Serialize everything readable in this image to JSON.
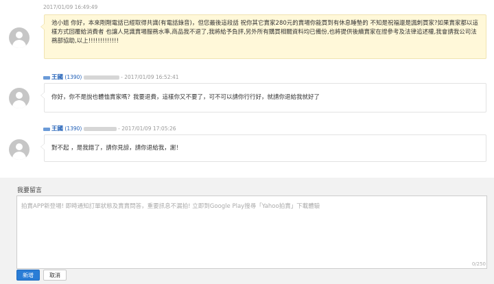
{
  "messages": [
    {
      "timestamp": "2017/01/09 16:49:49",
      "text": "池小姐 你好，本來剛剛電話已經取得共識(有電話錄音)，但您最後這段話 祝你其它賣家280元的賣場你能買到有休息睡墊的 不知是祝福還是諷刺買家?如果賣家都以這樣方式回覆給消費者 也讓人見識賣場服務水準,商品我不退了,我將給予負評,另外所有購買相關資料均已備份,也將提供後續賣家在證參考及法律追述權,我會請我公司法務部協助,以上!!!!!!!!!!!!!"
    },
    {
      "name": "王國",
      "uid": "(1390)",
      "separator": "-",
      "timestamp": "2017/01/09 16:52:41",
      "text": "你好，你不是說也體恤賣家嗎？我要退費，這樣你又不要了，可不可以請你行行好，就請你退給我就好了"
    },
    {
      "name": "王國",
      "uid": "(1390)",
      "separator": "-",
      "timestamp": "2017/01/09 17:05:26",
      "text": "對不起 ，是我錯了，請你見諒，請你退給我，謝！"
    }
  ],
  "reply": {
    "title": "我要留言",
    "placeholder": "拍賣APP新登場! 即時通知訂單狀態及賣賣問答，重要訊息不漏拍! 立即到Google Play搜尋「Yahoo拍賣」下載體驗",
    "counter": "0/250",
    "submit_label": "新增",
    "cancel_label": "取消"
  },
  "colors": {
    "seller_bubble": "#fff8d9",
    "link_blue": "#1a5bb5",
    "primary_button": "#2a7dd6",
    "reply_background": "#f2f2f2"
  }
}
